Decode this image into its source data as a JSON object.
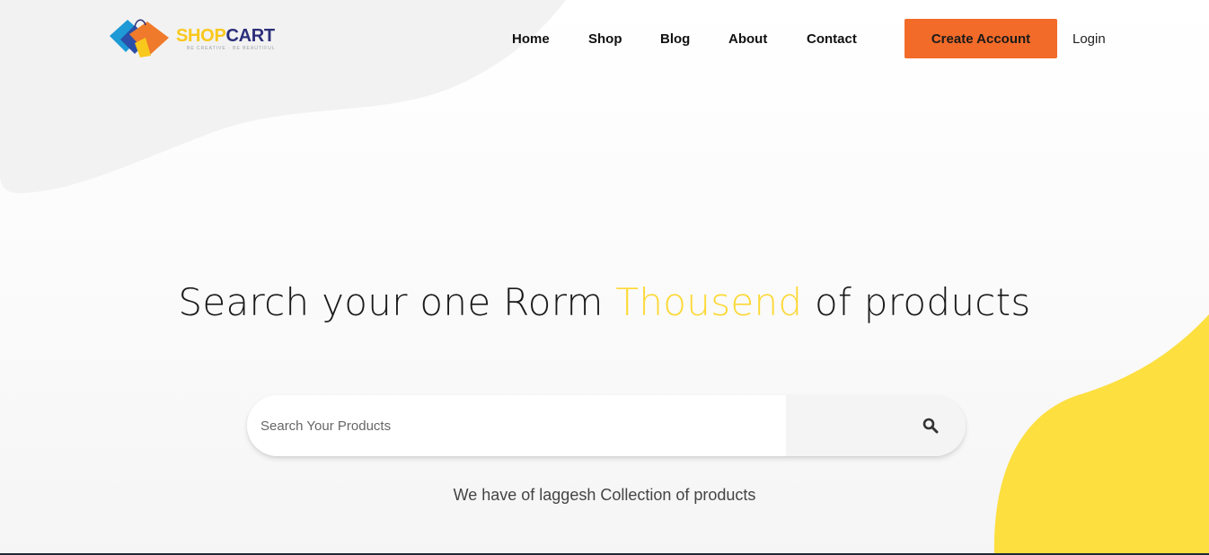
{
  "brand": {
    "name_part1": "SHOP",
    "name_part2": "CART",
    "tagline": "BE CREATIVE · BE BEAUTIFUL",
    "logo_icon": "shopping-bags-icon"
  },
  "nav": {
    "items": [
      {
        "label": "Home"
      },
      {
        "label": "Shop"
      },
      {
        "label": "Blog"
      },
      {
        "label": "About"
      },
      {
        "label": "Contact"
      }
    ],
    "create_account_label": "Create Account",
    "login_label": "Login"
  },
  "hero": {
    "title_before": "Search your one Rorm ",
    "title_accent": "Thousend",
    "title_after": " of products",
    "search_placeholder": "Search Your Products",
    "search_icon": "search-icon",
    "subtitle": "We have of laggesh Collection of products"
  },
  "colors": {
    "accent_orange": "#f26b29",
    "accent_yellow": "#fdd835",
    "brand_navy": "#2c2f7a",
    "brand_gold": "#f9c81d"
  }
}
